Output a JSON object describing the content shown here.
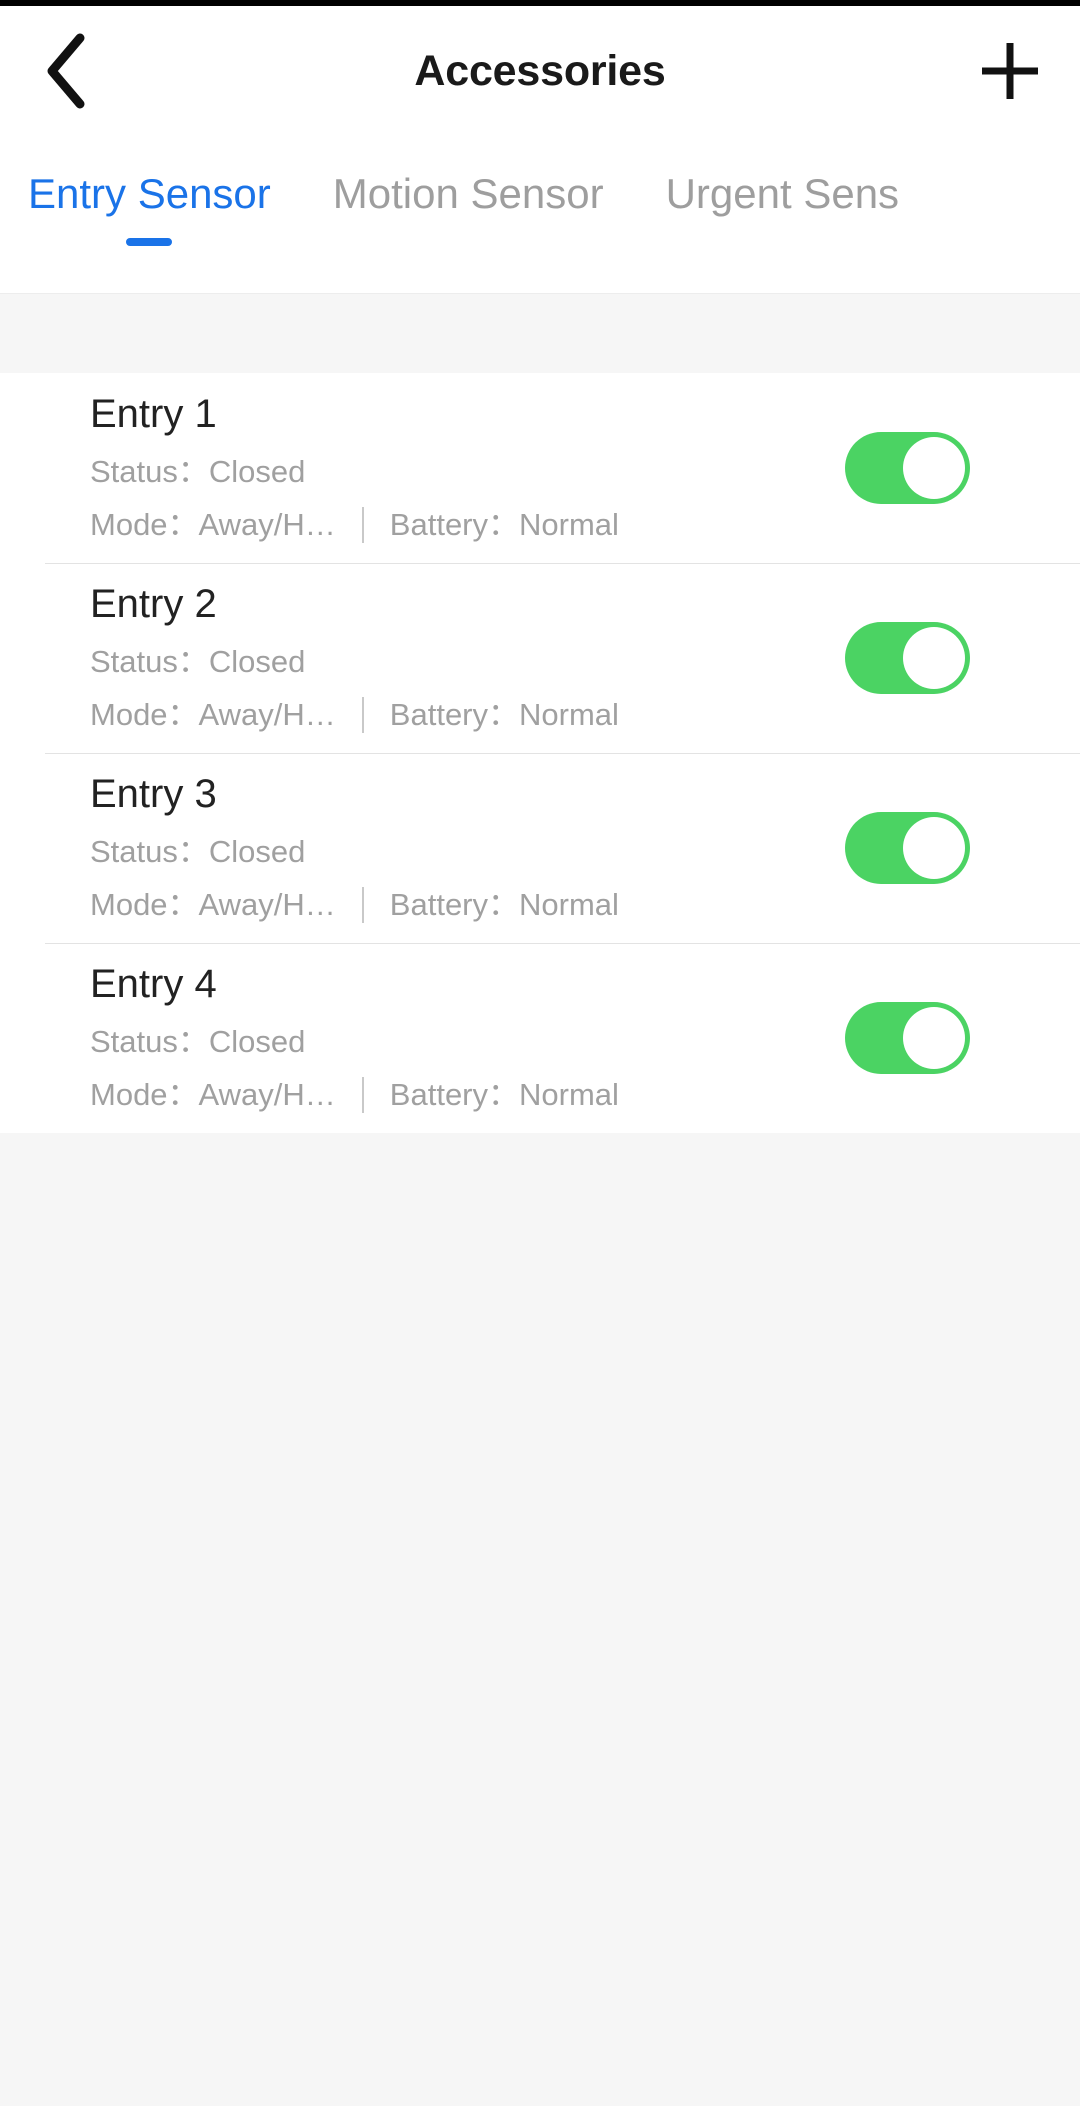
{
  "statusbar": {
    "color": "#000000"
  },
  "header": {
    "title": "Accessories",
    "back_icon": "chevron-left-icon",
    "add_icon": "plus-icon"
  },
  "tabs": {
    "active_index": 0,
    "items": [
      {
        "label": "Entry Sensor",
        "active": true
      },
      {
        "label": "Motion Sensor",
        "active": false
      },
      {
        "label": "Urgent Sens",
        "active": false
      }
    ]
  },
  "labels": {
    "status": "Status：",
    "mode": "Mode：",
    "battery": "Battery："
  },
  "colors": {
    "accent": "#1a73e8",
    "toggle_on": "#4bd363",
    "muted_text": "#a0a0a0",
    "title_text": "#222222",
    "page_bg": "#f6f6f6",
    "card_bg": "#ffffff"
  },
  "list": {
    "items": [
      {
        "name": "Entry 1",
        "status_value": "Closed",
        "mode_value": "Away/H…",
        "battery_value": "Normal",
        "enabled": true
      },
      {
        "name": "Entry 2",
        "status_value": "Closed",
        "mode_value": "Away/H…",
        "battery_value": "Normal",
        "enabled": true
      },
      {
        "name": "Entry 3",
        "status_value": "Closed",
        "mode_value": "Away/H…",
        "battery_value": "Normal",
        "enabled": true
      },
      {
        "name": "Entry 4",
        "status_value": "Closed",
        "mode_value": "Away/H…",
        "battery_value": "Normal",
        "enabled": true
      }
    ]
  }
}
